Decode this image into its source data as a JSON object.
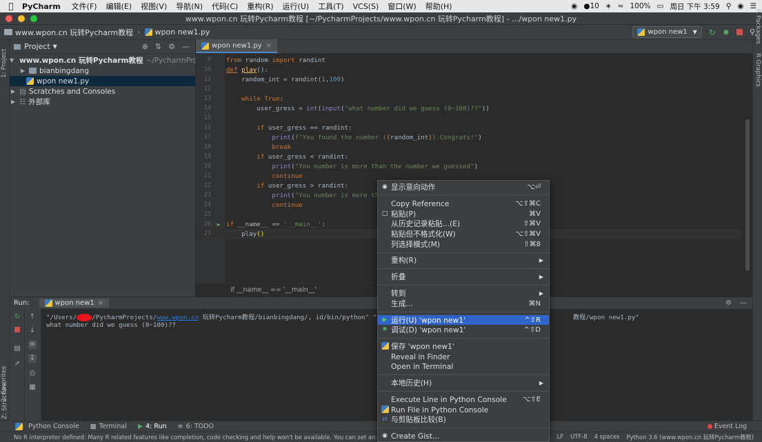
{
  "mac_menubar": {
    "apple": "",
    "app": "PyCharm",
    "menus": [
      "文件(F)",
      "编辑(E)",
      "视图(V)",
      "导航(N)",
      "代码(C)",
      "重构(R)",
      "运行(U)",
      "工具(T)",
      "VCS(S)",
      "窗口(W)",
      "帮助(H)"
    ],
    "wechat_count": "10",
    "battery": "100%",
    "clock": "周日 下午 3:59"
  },
  "window": {
    "title": "www.wpon.cn 玩转Pycharm教程 [~/PycharmProjects/www.wpon.cn 玩转Pycharm教程] - .../wpon new1.py"
  },
  "navbar": {
    "project": "www.wpon.cn 玩转Pycharm教程",
    "file": "wpon new1.py",
    "run_config": "wpon new1"
  },
  "left_strip": {
    "project_tab": "1: Project",
    "favorites_tab": "2: Favorites",
    "structure_tab": "Z: Structure"
  },
  "right_strip": {
    "r_packages": "R Packages",
    "r_graphics": "R Graphics"
  },
  "project_panel": {
    "title": "Project",
    "tree": [
      {
        "label": "www.wpon.cn 玩转Pycharm教程",
        "suffix": "~/PycharmProject",
        "expanded": true
      },
      {
        "label": "bianbingdang",
        "indent": 1
      },
      {
        "label": "wpon new1.py",
        "indent": 1,
        "selected": true
      },
      {
        "label": "Scratches and Consoles"
      },
      {
        "label": "外部库"
      }
    ]
  },
  "editor": {
    "tab": "wpon new1.py",
    "line_numbers": [
      "9",
      "10",
      "11",
      "12",
      "13",
      "14",
      "15",
      "16",
      "17",
      "18",
      "19",
      "20",
      "21",
      "22",
      "23",
      "24",
      "25",
      "26",
      "27"
    ],
    "breadcrumb": "if __name__ == '__main__'"
  },
  "run_panel": {
    "label": "Run:",
    "tab": "wpon new1",
    "line1_a": "\"/Users/",
    "line1_b": "/PycharmProjects/",
    "line1_link": "www.wpon.cn",
    "line1_c": " 玩转Pycharm教程/bianbingdang/, id/bin/python\" \"/Us",
    "line1_tail": "教程/wpon new1.py\"",
    "line2": "what number did we guess (0~100)??"
  },
  "bottom_tools": {
    "python_console": "Python Console",
    "terminal": "Terminal",
    "run": "4: Run",
    "todo": "6: TODO",
    "event_log": "Event Log"
  },
  "statusbar": {
    "message": "No R interpreter defined: Many R related features like completion, code checking and help won't be available. You can set an interpreter ur",
    "lf": "LF",
    "encoding": "UTF-8",
    "indent": "4 spaces",
    "interpreter": "Python 3.6 (www.wpon.cn 玩转Pycharm教程)"
  },
  "context_menu": {
    "items": [
      {
        "label": "显示意向动作",
        "shortcut": "⌥⏎",
        "icon": "bulb-icon"
      },
      {
        "label": "Copy Reference",
        "shortcut": "⌥⇧⌘C"
      },
      {
        "label": "粘贴(P)",
        "shortcut": "⌘V",
        "icon": "paste-icon"
      },
      {
        "label": "从历史记录粘贴...(E)",
        "shortcut": "⇧⌘V"
      },
      {
        "label": "粘贴但不格式化(W)",
        "shortcut": "⌥⇧⌘V"
      },
      {
        "label": "列选择模式(M)",
        "shortcut": "⇧⌘8"
      },
      {
        "label": "重构(R)",
        "submenu": true
      },
      {
        "label": "折叠",
        "submenu": true
      },
      {
        "label": "转到",
        "submenu": true
      },
      {
        "label": "生成...",
        "shortcut": "⌘N"
      },
      {
        "label": "运行(U) 'wpon new1'",
        "shortcut": "^⇧R",
        "icon": "run-icon",
        "active": true
      },
      {
        "label": "调试(D) 'wpon new1'",
        "shortcut": "^⇧D",
        "icon": "debug-icon"
      },
      {
        "label": "保存 'wpon new1'",
        "icon": "python-icon"
      },
      {
        "label": "Reveal in Finder"
      },
      {
        "label": "Open in Terminal"
      },
      {
        "label": "本地历史(H)",
        "submenu": true
      },
      {
        "label": "Execute Line in Python Console",
        "shortcut": "⌥⇧E"
      },
      {
        "label": "Run File in Python Console",
        "icon": "python-icon"
      },
      {
        "label": "与剪贴板比较(B)",
        "icon": "compare-icon"
      },
      {
        "label": "Create Gist...",
        "icon": "github-icon"
      }
    ]
  }
}
